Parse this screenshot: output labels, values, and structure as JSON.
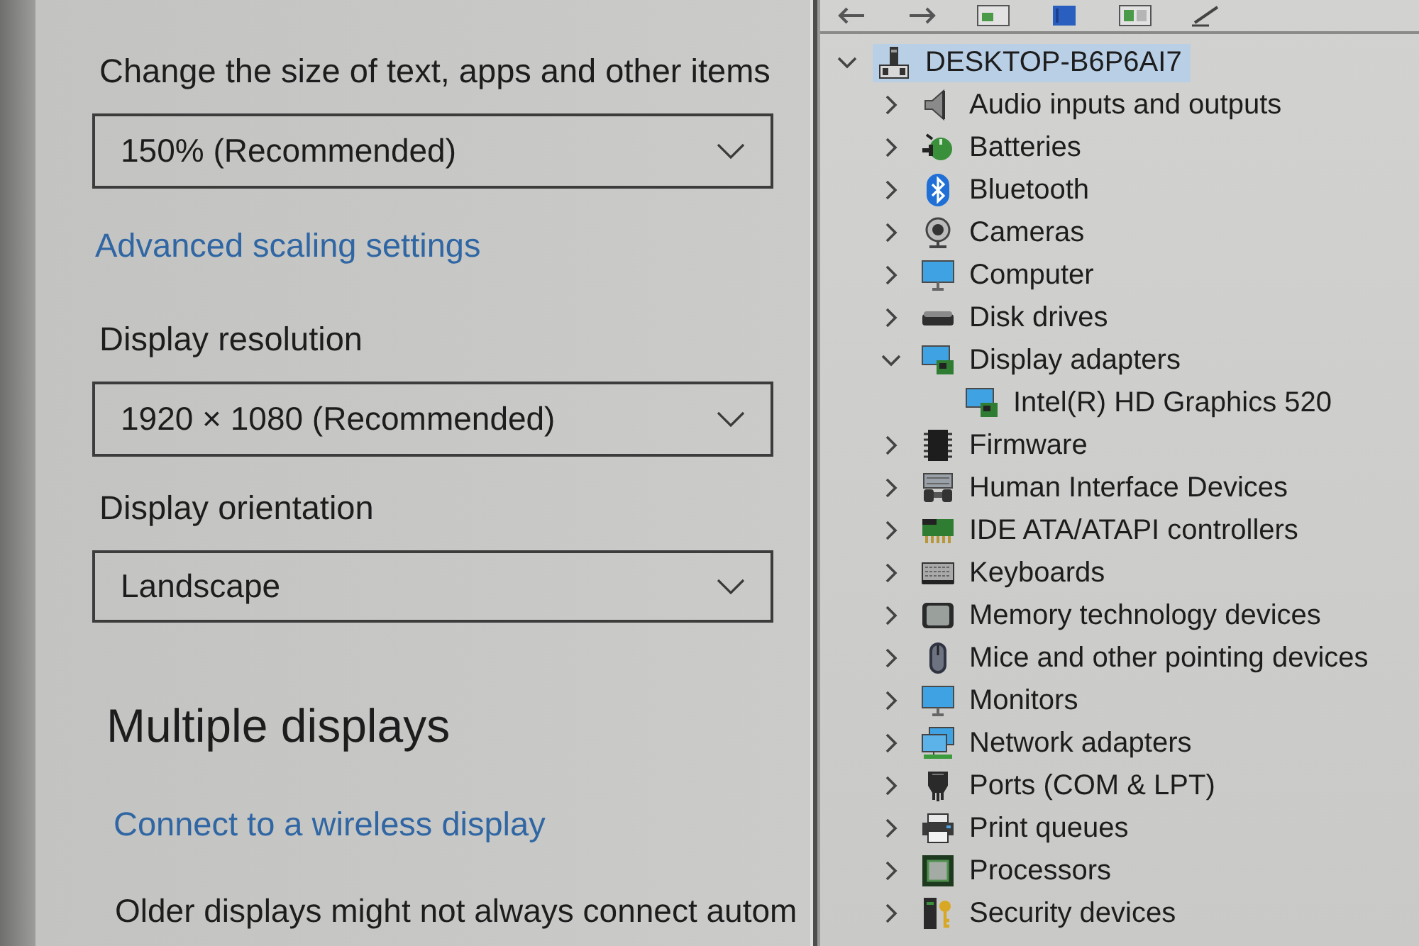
{
  "settings": {
    "items": [
      {
        "kind": "dropdown",
        "label": "Change the size of text, apps and other items",
        "value": "150% (Recommended)"
      },
      {
        "kind": "link",
        "label": "Advanced scaling settings"
      },
      {
        "kind": "dropdown",
        "label": "Display resolution",
        "value": "1920 × 1080 (Recommended)"
      },
      {
        "kind": "dropdown",
        "label": "Display orientation",
        "value": "Landscape"
      },
      {
        "kind": "heading",
        "text": "Multiple displays"
      },
      {
        "kind": "link",
        "label": "Connect to a wireless display"
      },
      {
        "kind": "paragraph",
        "text": "Older displays might not always connect autom"
      }
    ]
  },
  "device_manager": {
    "tree": [
      {
        "label": "DESKTOP-B6P6AI7",
        "expanded": true,
        "selected": true,
        "children": [
          {
            "label": "Audio inputs and outputs",
            "expanded": false,
            "selected": false
          },
          {
            "label": "Batteries",
            "expanded": false,
            "selected": false
          },
          {
            "label": "Bluetooth",
            "expanded": false,
            "selected": false
          },
          {
            "label": "Cameras",
            "expanded": false,
            "selected": false
          },
          {
            "label": "Computer",
            "expanded": false,
            "selected": false
          },
          {
            "label": "Disk drives",
            "expanded": false,
            "selected": false
          },
          {
            "label": "Display adapters",
            "expanded": true,
            "selected": false,
            "children": [
              {
                "label": "Intel(R) HD Graphics 520",
                "selected": false
              }
            ]
          },
          {
            "label": "Firmware",
            "expanded": false,
            "selected": false
          },
          {
            "label": "Human Interface Devices",
            "expanded": false,
            "selected": false
          },
          {
            "label": "IDE ATA/ATAPI controllers",
            "expanded": false,
            "selected": false
          },
          {
            "label": "Keyboards",
            "expanded": false,
            "selected": false
          },
          {
            "label": "Memory technology devices",
            "expanded": false,
            "selected": false
          },
          {
            "label": "Mice and other pointing devices",
            "expanded": false,
            "selected": false
          },
          {
            "label": "Monitors",
            "expanded": false,
            "selected": false
          },
          {
            "label": "Network adapters",
            "expanded": false,
            "selected": false
          },
          {
            "label": "Ports (COM & LPT)",
            "expanded": false,
            "selected": false
          },
          {
            "label": "Print queues",
            "expanded": false,
            "selected": false
          },
          {
            "label": "Processors",
            "expanded": false,
            "selected": false
          },
          {
            "label": "Security devices",
            "expanded": false,
            "selected": false
          }
        ]
      }
    ]
  }
}
